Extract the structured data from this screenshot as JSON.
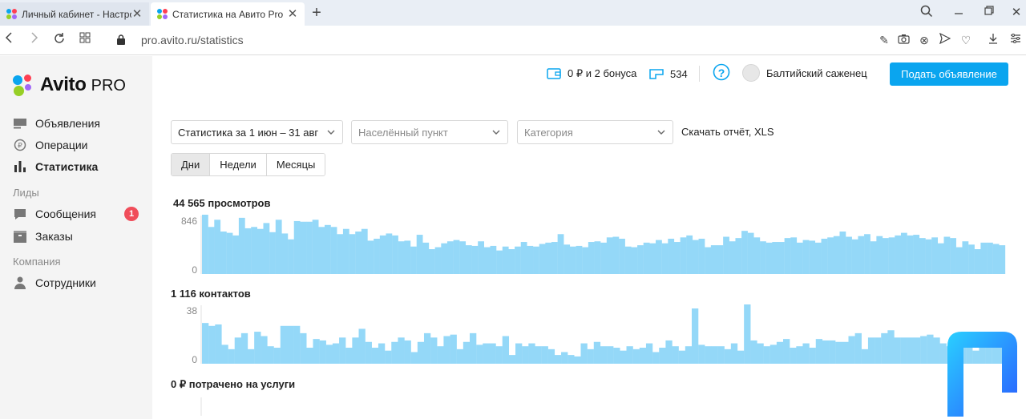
{
  "browser": {
    "tabs": [
      {
        "label": "Личный кабинет - Настро"
      },
      {
        "label": "Статистика на Авито Pro"
      }
    ],
    "url": "pro.avito.ru/statistics"
  },
  "brand": {
    "name": "Avito",
    "suffix": "PRO"
  },
  "sidebar": {
    "items": [
      {
        "label": "Объявления",
        "icon": "listings-icon"
      },
      {
        "label": "Операции",
        "icon": "operations-icon"
      },
      {
        "label": "Статистика",
        "icon": "bar-chart-icon",
        "active": true
      }
    ],
    "section_leads": "Лиды",
    "leads": [
      {
        "label": "Сообщения",
        "icon": "chat-icon",
        "badge": "1"
      },
      {
        "label": "Заказы",
        "icon": "orders-icon"
      }
    ],
    "section_company": "Компания",
    "company": [
      {
        "label": "Сотрудники",
        "icon": "person-icon"
      }
    ]
  },
  "header": {
    "wallet": "0 ₽ и 2 бонуса",
    "ads_count": "534",
    "help": "?",
    "account": "Балтийский саженец",
    "post_button": "Подать объявление"
  },
  "filters": {
    "period": "Статистика за 1 июн – 31 авг",
    "city_placeholder": "Населённый пункт",
    "category_placeholder": "Категория",
    "download": "Скачать отчёт, XLS",
    "granularity": [
      "Дни",
      "Недели",
      "Месяцы"
    ],
    "granularity_selected": "Дни"
  },
  "colors": {
    "accent": "#0aa5ef",
    "bar": "#94d8f8",
    "badge": "#f04d5a"
  },
  "chart_data": [
    {
      "type": "bar",
      "title": "44 565 просмотров",
      "ylim": [
        0,
        846
      ],
      "yticks": [
        "846",
        "0"
      ],
      "values": [
        940,
        720,
        830,
        650,
        630,
        590,
        860,
        700,
        720,
        690,
        780,
        640,
        830,
        620,
        530,
        810,
        800,
        800,
        830,
        720,
        750,
        720,
        610,
        690,
        610,
        650,
        690,
        510,
        540,
        590,
        620,
        590,
        500,
        510,
        420,
        600,
        480,
        380,
        410,
        470,
        500,
        520,
        500,
        440,
        430,
        500,
        410,
        430,
        360,
        420,
        380,
        420,
        490,
        430,
        420,
        460,
        480,
        490,
        610,
        450,
        420,
        430,
        410,
        490,
        500,
        480,
        560,
        570,
        540,
        420,
        410,
        440,
        480,
        470,
        520,
        470,
        540,
        490,
        560,
        590,
        520,
        540,
        410,
        440,
        440,
        570,
        500,
        550,
        660,
        630,
        560,
        500,
        480,
        490,
        490,
        550,
        560,
        480,
        520,
        510,
        480,
        540,
        560,
        580,
        650,
        570,
        530,
        580,
        610,
        500,
        580,
        550,
        560,
        590,
        630,
        590,
        600,
        550,
        530,
        560,
        470,
        570,
        550,
        410,
        500,
        450,
        380,
        480,
        480,
        460,
        440
      ]
    },
    {
      "type": "bar",
      "title": "1 116 контактов",
      "ylim": [
        0,
        38
      ],
      "yticks": [
        "38",
        "0"
      ],
      "values": [
        28,
        26,
        27,
        13,
        10,
        18,
        21,
        10,
        22,
        19,
        12,
        11,
        26,
        26,
        26,
        21,
        11,
        17,
        16,
        13,
        14,
        18,
        11,
        18,
        24,
        15,
        11,
        14,
        9,
        15,
        18,
        16,
        8,
        15,
        21,
        18,
        12,
        19,
        20,
        10,
        15,
        21,
        13,
        14,
        14,
        12,
        19,
        6,
        14,
        12,
        14,
        12,
        12,
        10,
        6,
        8,
        6,
        5,
        14,
        10,
        15,
        12,
        12,
        11,
        9,
        12,
        10,
        11,
        14,
        8,
        11,
        16,
        12,
        9,
        12,
        38,
        13,
        12,
        12,
        12,
        10,
        14,
        9,
        46,
        16,
        14,
        12,
        13,
        15,
        17,
        11,
        12,
        14,
        11,
        17,
        16,
        16,
        15,
        15,
        19,
        21,
        10,
        18,
        18,
        21,
        23,
        18,
        18,
        18,
        18,
        19,
        20,
        18,
        14,
        12,
        16,
        17,
        19,
        9,
        20,
        15,
        16,
        22
      ]
    },
    {
      "type": "bar",
      "title": "0 ₽ потрачено на услуги",
      "values": []
    }
  ]
}
